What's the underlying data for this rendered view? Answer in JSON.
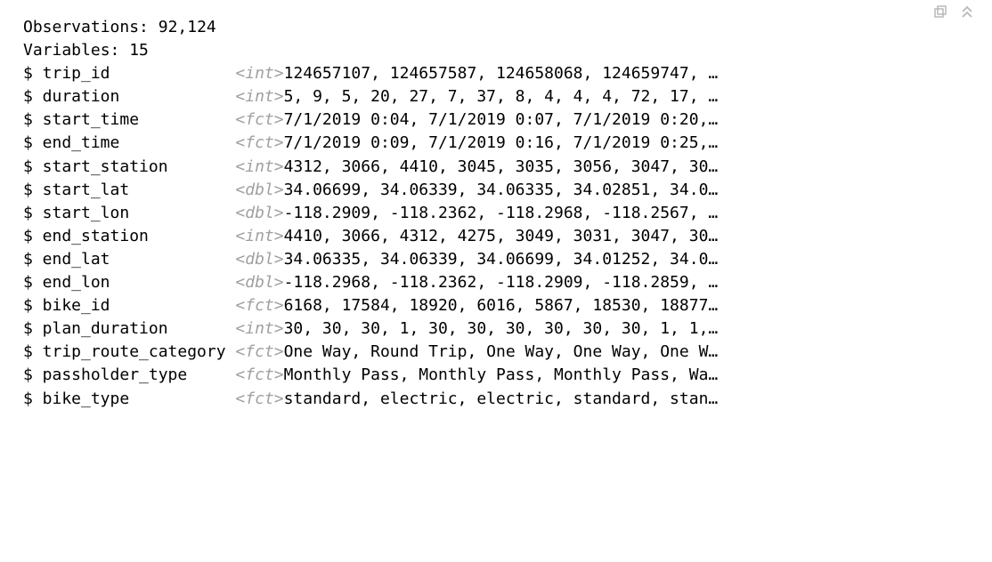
{
  "toolbar": {
    "popout_title": "Show in new window",
    "collapse_title": "Collapse output"
  },
  "summary": {
    "observations_label": "Observations:",
    "observations_value": "92,124",
    "variables_label": "Variables:",
    "variables_value": "15"
  },
  "variables": [
    {
      "name": "trip_id",
      "type": "<int>",
      "values": " 124657107, 124657587, 124658068, 124659747, …"
    },
    {
      "name": "duration",
      "type": "<int>",
      "values": " 5, 9, 5, 20, 27, 7, 37, 8, 4, 4, 4, 72, 17, …"
    },
    {
      "name": "start_time",
      "type": "<fct>",
      "values": " 7/1/2019 0:04, 7/1/2019 0:07, 7/1/2019 0:20,…"
    },
    {
      "name": "end_time",
      "type": "<fct>",
      "values": " 7/1/2019 0:09, 7/1/2019 0:16, 7/1/2019 0:25,…"
    },
    {
      "name": "start_station",
      "type": "<int>",
      "values": " 4312, 3066, 4410, 3045, 3035, 3056, 3047, 30…"
    },
    {
      "name": "start_lat",
      "type": "<dbl>",
      "values": " 34.06699, 34.06339, 34.06335, 34.02851, 34.0…"
    },
    {
      "name": "start_lon",
      "type": "<dbl>",
      "values": " -118.2909, -118.2362, -118.2968, -118.2567, …"
    },
    {
      "name": "end_station",
      "type": "<int>",
      "values": " 4410, 3066, 4312, 4275, 3049, 3031, 3047, 30…"
    },
    {
      "name": "end_lat",
      "type": "<dbl>",
      "values": " 34.06335, 34.06339, 34.06699, 34.01252, 34.0…"
    },
    {
      "name": "end_lon",
      "type": "<dbl>",
      "values": " -118.2968, -118.2362, -118.2909, -118.2859, …"
    },
    {
      "name": "bike_id",
      "type": "<fct>",
      "values": " 6168, 17584, 18920, 6016, 5867, 18530, 18877…"
    },
    {
      "name": "plan_duration",
      "type": "<int>",
      "values": " 30, 30, 30, 1, 30, 30, 30, 30, 30, 30, 1, 1,…"
    },
    {
      "name": "trip_route_category",
      "type": "<fct>",
      "values": " One Way, Round Trip, One Way, One Way, One W…"
    },
    {
      "name": "passholder_type",
      "type": "<fct>",
      "values": " Monthly Pass, Monthly Pass, Monthly Pass, Wa…"
    },
    {
      "name": "bike_type",
      "type": "<fct>",
      "values": " standard, electric, electric, standard, stan…"
    }
  ]
}
